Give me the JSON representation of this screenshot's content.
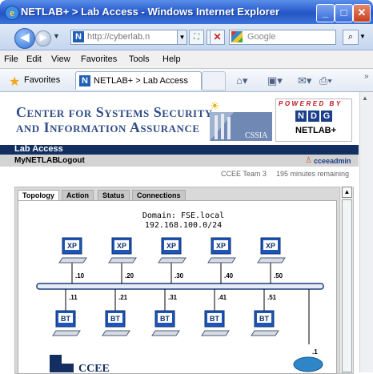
{
  "window": {
    "title": "NETLAB+ > Lab Access - Windows Internet Explorer",
    "minimize": "_",
    "maximize": "□",
    "close": "✕"
  },
  "addressbar": {
    "url": "http://cyberlab.n",
    "search_placeholder": "Google"
  },
  "menubar": [
    "File",
    "Edit",
    "View",
    "Favorites",
    "Tools",
    "Help"
  ],
  "favorites": {
    "label": "Favorites",
    "tab_title": "NETLAB+ > Lab Access"
  },
  "page": {
    "banner_line1": "Center for Systems Security",
    "banner_line2": "and Information Assurance",
    "cssia_logo_text": "CSSIA",
    "powered_by": "POWERED BY",
    "ndg_letters": [
      "N",
      "D",
      "G"
    ],
    "netlab_brand": "NETLAB+",
    "section_title": "Lab Access",
    "nav_mynetlab": "MyNETLAB",
    "nav_logout": "Logout",
    "user": "cceeadmin",
    "team": "CCEE Team 3",
    "time_remaining": "195 minutes remaining"
  },
  "tabs": [
    "Topology",
    "Action",
    "Status",
    "Connections"
  ],
  "topology": {
    "domain": "Domain: FSE.local",
    "subnet": "192.168.100.0/24",
    "top_hosts": [
      {
        "label": "XP",
        "ip": ".10"
      },
      {
        "label": "XP",
        "ip": ".20"
      },
      {
        "label": "XP",
        "ip": ".30"
      },
      {
        "label": "XP",
        "ip": ".40"
      },
      {
        "label": "XP",
        "ip": ".50"
      }
    ],
    "bottom_hosts": [
      {
        "label": "BT",
        "ip": ".11"
      },
      {
        "label": "BT",
        "ip": ".21"
      },
      {
        "label": "BT",
        "ip": ".31"
      },
      {
        "label": "BT",
        "ip": ".41"
      },
      {
        "label": "BT",
        "ip": ".51"
      }
    ],
    "router_ip": ".1",
    "ccee_logo_text": "CCEE"
  },
  "colors": {
    "xp_screen": "#1d56b8",
    "bt_screen": "#1d56b8",
    "section_bar": "#132f62",
    "banner_text": "#2f4e87",
    "router": "#2e86c8"
  }
}
